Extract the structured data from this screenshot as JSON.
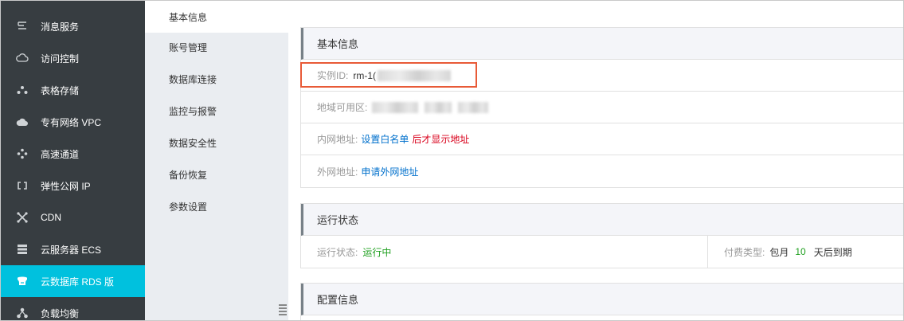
{
  "sidebar": {
    "items": [
      {
        "label": "消息服务",
        "icon": "message-icon"
      },
      {
        "label": "访问控制",
        "icon": "cloud-key-icon"
      },
      {
        "label": "表格存储",
        "icon": "table-store-icon"
      },
      {
        "label": "专有网络 VPC",
        "icon": "cloud-network-icon"
      },
      {
        "label": "高速通道",
        "icon": "express-connect-icon"
      },
      {
        "label": "弹性公网 IP",
        "icon": "eip-icon"
      },
      {
        "label": "CDN",
        "icon": "cdn-icon"
      },
      {
        "label": "云服务器 ECS",
        "icon": "server-icon"
      },
      {
        "label": "云数据库 RDS 版",
        "icon": "database-icon"
      },
      {
        "label": "负载均衡",
        "icon": "load-balancer-icon"
      }
    ],
    "active_index": 8,
    "active_color": "#00c1de"
  },
  "subnav": {
    "items": [
      {
        "label": "基本信息"
      },
      {
        "label": "账号管理"
      },
      {
        "label": "数据库连接"
      },
      {
        "label": "监控与报警"
      },
      {
        "label": "数据安全性"
      },
      {
        "label": "备份恢复"
      },
      {
        "label": "参数设置"
      }
    ],
    "active_index": 0
  },
  "basic": {
    "title": "基本信息",
    "instance_label": "实例ID:",
    "instance_value": "rm-1(",
    "region_label": "地域可用区:",
    "intranet_label": "内网地址:",
    "intranet_link": "设置白名单",
    "intranet_note": "后才显示地址",
    "extranet_label": "外网地址:",
    "extranet_link": "申请外网地址"
  },
  "status": {
    "title": "运行状态",
    "run_label": "运行状态:",
    "run_value": "运行中",
    "pay_label": "付费类型:",
    "pay_value_prefix": "包月",
    "pay_days": "10",
    "pay_value_suffix": "天后到期"
  },
  "config": {
    "title": "配置信息"
  },
  "colors": {
    "link": "#0070cc",
    "alert": "#d9001b",
    "ok": "#1e9f1e",
    "highlight": "#e85a37"
  }
}
